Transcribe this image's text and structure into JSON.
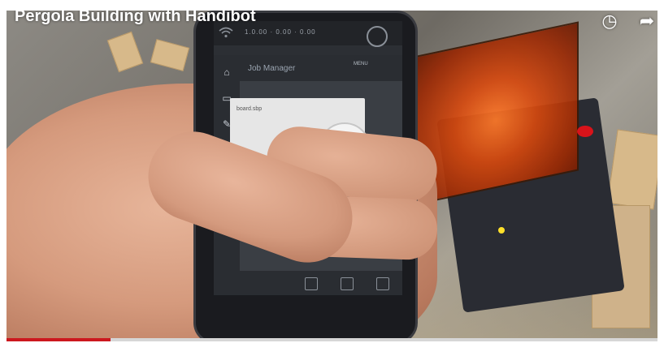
{
  "video": {
    "title": "Pergola Building with Handibot",
    "progress_fraction": 0.16
  },
  "player_icons": {
    "clock": "clock-icon",
    "share": "share-icon"
  },
  "app": {
    "status_text": "1.0.00   ·   0.00   ·   0.00",
    "header_title": "Job Manager",
    "menu_label": "MENU",
    "card_title": "board.sbp",
    "sidebar_icons": [
      "home-icon",
      "layers-icon",
      "pencil-icon",
      "gear-icon",
      "more-icon"
    ],
    "bottom_icons": [
      "upload-icon",
      "folder-icon",
      "trash-icon"
    ]
  },
  "colors": {
    "progress": "#cc181e",
    "run_button": "#d0141b",
    "machine_cover": "#d64a10"
  }
}
